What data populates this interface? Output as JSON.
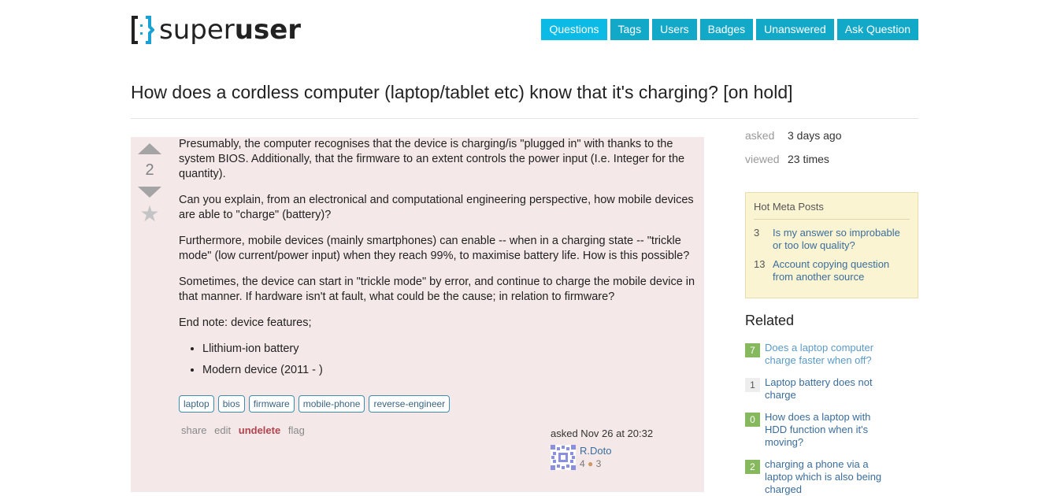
{
  "header": {
    "logo_text_light": "super",
    "logo_text_bold": "user",
    "nav": [
      {
        "label": "Questions",
        "active": true
      },
      {
        "label": "Tags"
      },
      {
        "label": "Users"
      },
      {
        "label": "Badges"
      },
      {
        "label": "Unanswered"
      },
      {
        "label": "Ask Question"
      }
    ]
  },
  "question": {
    "title": "How does a cordless computer (laptop/tablet etc) know that it's charging? [on hold]",
    "votes": "2",
    "paragraphs": [
      "Presumably, the computer recognises that the device is charging/is \"plugged in\" with thanks to the system BIOS. Additionally, that the firmware to an extent controls the power input (I.e. Integer for the quantity).",
      "Can you explain, from an electronical and computational engineering perspective, how mobile devices are able to \"charge\" (battery)?",
      "Furthermore, mobile devices (mainly smartphones) can enable -- when in a charging state -- \"trickle mode\" (low current/power input) when they reach 99%, to maximise battery life. How is this possible?",
      "Sometimes, the device can start in \"trickle mode\" by error, and continue to charge the mobile device in that manner. If hardware isn't at fault, what could be the cause; in relation to firmware?",
      "End note: device features;"
    ],
    "features": [
      "Llithium-ion battery",
      "Modern device (2011 - )"
    ],
    "tags": [
      "laptop",
      "bios",
      "firmware",
      "mobile-phone",
      "reverse-engineer"
    ],
    "actions": {
      "share": "share",
      "edit": "edit",
      "undelete": "undelete",
      "flag": "flag"
    },
    "owner": {
      "asked": "asked Nov 26 at 20:32",
      "name": "R.Doto",
      "reputation": "4",
      "bronze_badges": "3"
    }
  },
  "sidebar": {
    "asked_label": "asked",
    "asked_value": "3 days ago",
    "viewed_label": "viewed",
    "viewed_value": "23 times",
    "hot_meta": {
      "title": "Hot Meta Posts",
      "items": [
        {
          "count": "3",
          "title": "Is my answer so improbable or too low quality?"
        },
        {
          "count": "13",
          "title": "Account copying question from another source"
        }
      ]
    },
    "related": {
      "title": "Related",
      "items": [
        {
          "score": "7",
          "title": "Does a laptop computer charge faster when off?",
          "accepted": true,
          "visited": true
        },
        {
          "score": "1",
          "title": "Laptop battery does not charge",
          "accepted": false,
          "visited": false
        },
        {
          "score": "0",
          "title": "How does a laptop with HDD function when it's moving?",
          "accepted": true,
          "visited": false
        },
        {
          "score": "2",
          "title": "charging a phone via a laptop which is also being charged",
          "accepted": true,
          "visited": false
        }
      ]
    }
  },
  "colors": {
    "nav_bg": "#12a9c9",
    "post_bg": "#f4e9e8",
    "link": "#3a6d9c",
    "accepted_score": "#86b85d",
    "hot_meta_bg": "#fbf4d3"
  }
}
